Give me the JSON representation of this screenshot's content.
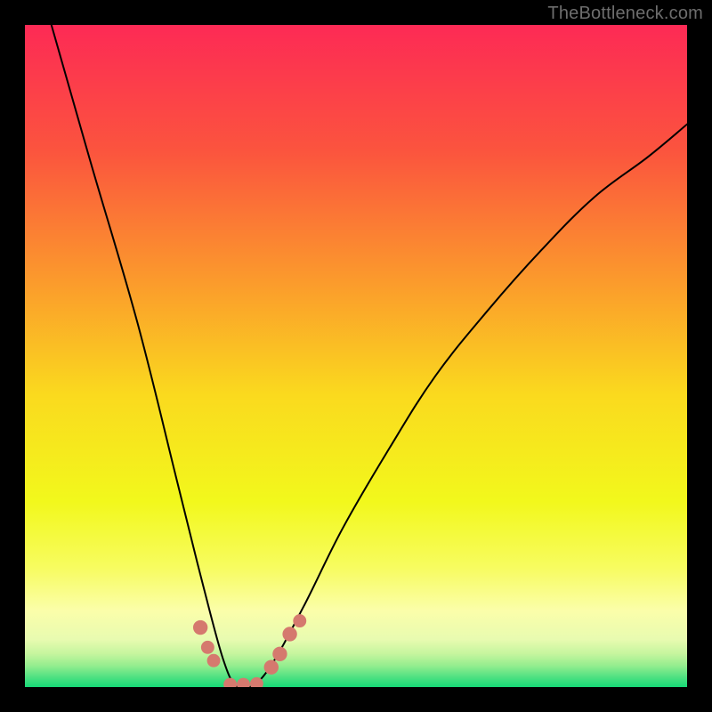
{
  "watermark": "TheBottleneck.com",
  "chart_data": {
    "type": "line",
    "title": "",
    "xlabel": "",
    "ylabel": "",
    "xlim": [
      0,
      100
    ],
    "ylim": [
      0,
      100
    ],
    "grid": false,
    "series": [
      {
        "name": "bottleneck-curve",
        "x": [
          4,
          10,
          17,
          23,
          27,
          30,
          32,
          34,
          37,
          42,
          48,
          55,
          62,
          70,
          78,
          86,
          94,
          100
        ],
        "y": [
          100,
          79,
          55,
          31,
          15,
          4,
          0,
          0,
          3,
          12,
          24,
          36,
          47,
          57,
          66,
          74,
          80,
          85
        ]
      }
    ],
    "markers": [
      {
        "x": 26.5,
        "y": 9,
        "r": 1.1,
        "color": "#d5796e"
      },
      {
        "x": 27.6,
        "y": 6,
        "r": 1.0,
        "color": "#d5796e"
      },
      {
        "x": 28.5,
        "y": 4,
        "r": 1.0,
        "color": "#d5796e"
      },
      {
        "x": 31,
        "y": 0.4,
        "r": 1.0,
        "color": "#d5796e"
      },
      {
        "x": 33,
        "y": 0.4,
        "r": 1.0,
        "color": "#d5796e"
      },
      {
        "x": 35,
        "y": 0.5,
        "r": 1.0,
        "color": "#d5796e"
      },
      {
        "x": 37.2,
        "y": 3,
        "r": 1.1,
        "color": "#d5796e"
      },
      {
        "x": 38.5,
        "y": 5,
        "r": 1.1,
        "color": "#d5796e"
      },
      {
        "x": 40.0,
        "y": 8,
        "r": 1.1,
        "color": "#d5796e"
      },
      {
        "x": 41.5,
        "y": 10,
        "r": 1.0,
        "color": "#d5796e"
      }
    ],
    "gradient_stops": [
      {
        "offset": 0,
        "color": "#fd2a55"
      },
      {
        "offset": 0.19,
        "color": "#fb543e"
      },
      {
        "offset": 0.4,
        "color": "#fb9f2b"
      },
      {
        "offset": 0.56,
        "color": "#fada1e"
      },
      {
        "offset": 0.72,
        "color": "#f2f81c"
      },
      {
        "offset": 0.82,
        "color": "#f7fc60"
      },
      {
        "offset": 0.885,
        "color": "#fbfeaa"
      },
      {
        "offset": 0.928,
        "color": "#e8fbb0"
      },
      {
        "offset": 0.95,
        "color": "#c5f59e"
      },
      {
        "offset": 0.968,
        "color": "#93ed8e"
      },
      {
        "offset": 0.985,
        "color": "#4fe182"
      },
      {
        "offset": 1.0,
        "color": "#16d977"
      }
    ]
  }
}
